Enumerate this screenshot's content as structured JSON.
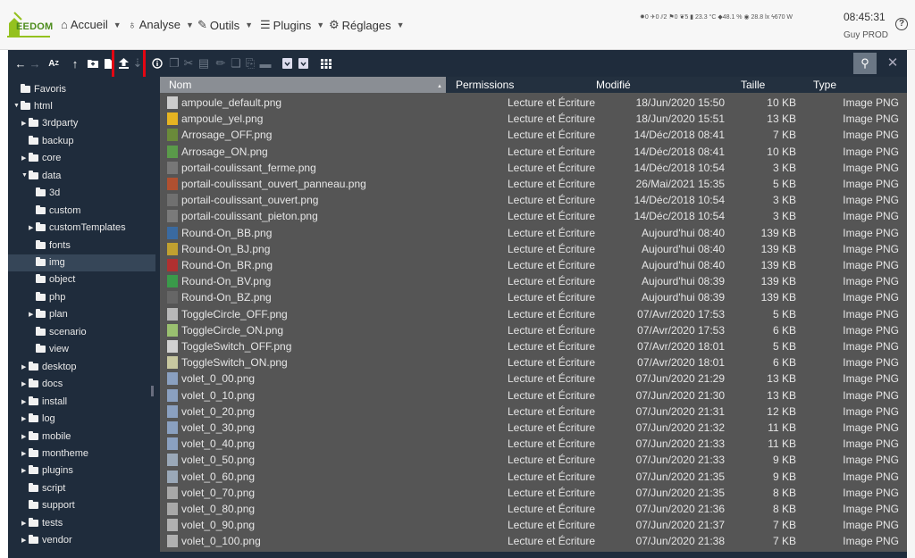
{
  "nav": {
    "logo_text": "EEDOM",
    "items": [
      {
        "label": "Accueil",
        "icon": "home-icon"
      },
      {
        "label": "Analyse",
        "icon": "stethoscope-icon"
      },
      {
        "label": "Outils",
        "icon": "wrench-icon"
      },
      {
        "label": "Plugins",
        "icon": "list-icon"
      },
      {
        "label": "Réglages",
        "icon": "gear-icon"
      }
    ],
    "status_strip": "✹0 ✈0 ⫽2 ⚑0 ❦5 ▮ 23.3 °C ◆48.1 % ◉ 28.8 lx ϟ670 W",
    "time": "08:45:31",
    "user": "Guy PROD",
    "help": "?"
  },
  "colors": {
    "accent": "#e30613",
    "toolbar_bg": "#1f2c3c",
    "list_bg": "#555555",
    "header_sel": "#8a8e94"
  },
  "toolbar": {
    "icons": [
      "arrow-left-icon",
      "arrow-right-icon",
      "sort-az-icon",
      "arrow-up-icon",
      "new-folder-icon",
      "new-file-icon",
      "upload-icon",
      "download-icon",
      "info-icon",
      "copy-icon",
      "cut-icon",
      "paste-icon",
      "rename-icon",
      "duplicate-icon",
      "extract-icon",
      "trash-icon",
      "archive-icon",
      "unarchive-icon",
      "grid-view-icon",
      "search-icon",
      "close-icon"
    ],
    "highlighted": "upload-icon"
  },
  "tree": [
    {
      "label": "Favoris",
      "level": 0,
      "twisty": "",
      "icon": "bookmark"
    },
    {
      "label": "html",
      "level": 0,
      "twisty": "▼"
    },
    {
      "label": "3rdparty",
      "level": 1,
      "twisty": "▶"
    },
    {
      "label": "backup",
      "level": 1,
      "twisty": ""
    },
    {
      "label": "core",
      "level": 1,
      "twisty": "▶"
    },
    {
      "label": "data",
      "level": 1,
      "twisty": "▼"
    },
    {
      "label": "3d",
      "level": 2,
      "twisty": ""
    },
    {
      "label": "custom",
      "level": 2,
      "twisty": ""
    },
    {
      "label": "customTemplates",
      "level": 2,
      "twisty": "▶"
    },
    {
      "label": "fonts",
      "level": 2,
      "twisty": ""
    },
    {
      "label": "img",
      "level": 2,
      "twisty": "",
      "selected": true
    },
    {
      "label": "object",
      "level": 2,
      "twisty": ""
    },
    {
      "label": "php",
      "level": 2,
      "twisty": ""
    },
    {
      "label": "plan",
      "level": 2,
      "twisty": "▶"
    },
    {
      "label": "scenario",
      "level": 2,
      "twisty": ""
    },
    {
      "label": "view",
      "level": 2,
      "twisty": ""
    },
    {
      "label": "desktop",
      "level": 1,
      "twisty": "▶"
    },
    {
      "label": "docs",
      "level": 1,
      "twisty": "▶"
    },
    {
      "label": "install",
      "level": 1,
      "twisty": "▶"
    },
    {
      "label": "log",
      "level": 1,
      "twisty": "▶"
    },
    {
      "label": "mobile",
      "level": 1,
      "twisty": "▶"
    },
    {
      "label": "montheme",
      "level": 1,
      "twisty": "▶"
    },
    {
      "label": "plugins",
      "level": 1,
      "twisty": "▶"
    },
    {
      "label": "script",
      "level": 1,
      "twisty": ""
    },
    {
      "label": "support",
      "level": 1,
      "twisty": ""
    },
    {
      "label": "tests",
      "level": 1,
      "twisty": "▶"
    },
    {
      "label": "vendor",
      "level": 1,
      "twisty": "▶"
    }
  ],
  "columns": {
    "name": "Nom",
    "perms": "Permissions",
    "mod": "Modifié",
    "size": "Taille",
    "type": "Type"
  },
  "files": [
    {
      "name": "ampoule_default.png",
      "perm": "Lecture et Écriture",
      "mod": "18/Jun/2020 15:50",
      "size": "10 KB",
      "type": "Image PNG",
      "thumb": "#cccccc"
    },
    {
      "name": "ampoule_yel.png",
      "perm": "Lecture et Écriture",
      "mod": "18/Jun/2020 15:51",
      "size": "13 KB",
      "type": "Image PNG",
      "thumb": "#e6b422"
    },
    {
      "name": "Arrosage_OFF.png",
      "perm": "Lecture et Écriture",
      "mod": "14/Déc/2018 08:41",
      "size": "7 KB",
      "type": "Image PNG",
      "thumb": "#6a8a3a"
    },
    {
      "name": "Arrosage_ON.png",
      "perm": "Lecture et Écriture",
      "mod": "14/Déc/2018 08:41",
      "size": "10 KB",
      "type": "Image PNG",
      "thumb": "#5a9a4a"
    },
    {
      "name": "portail-coulissant_ferme.png",
      "perm": "Lecture et Écriture",
      "mod": "14/Déc/2018 10:54",
      "size": "3 KB",
      "type": "Image PNG",
      "thumb": "#777777"
    },
    {
      "name": "portail-coulissant_ouvert_panneau.png",
      "perm": "Lecture et Écriture",
      "mod": "26/Mai/2021 15:35",
      "size": "5 KB",
      "type": "Image PNG",
      "thumb": "#b05030"
    },
    {
      "name": "portail-coulissant_ouvert.png",
      "perm": "Lecture et Écriture",
      "mod": "14/Déc/2018 10:54",
      "size": "3 KB",
      "type": "Image PNG",
      "thumb": "#707070"
    },
    {
      "name": "portail-coulissant_pieton.png",
      "perm": "Lecture et Écriture",
      "mod": "14/Déc/2018 10:54",
      "size": "3 KB",
      "type": "Image PNG",
      "thumb": "#7a7a7a"
    },
    {
      "name": "Round-On_BB.png",
      "perm": "Lecture et Écriture",
      "mod": "Aujourd'hui 08:40",
      "size": "139 KB",
      "type": "Image PNG",
      "thumb": "#3a6aa0"
    },
    {
      "name": "Round-On_BJ.png",
      "perm": "Lecture et Écriture",
      "mod": "Aujourd'hui 08:40",
      "size": "139 KB",
      "type": "Image PNG",
      "thumb": "#c0a030"
    },
    {
      "name": "Round-On_BR.png",
      "perm": "Lecture et Écriture",
      "mod": "Aujourd'hui 08:40",
      "size": "139 KB",
      "type": "Image PNG",
      "thumb": "#b03030"
    },
    {
      "name": "Round-On_BV.png",
      "perm": "Lecture et Écriture",
      "mod": "Aujourd'hui 08:39",
      "size": "139 KB",
      "type": "Image PNG",
      "thumb": "#3a9a4a"
    },
    {
      "name": "Round-On_BZ.png",
      "perm": "Lecture et Écriture",
      "mod": "Aujourd'hui 08:39",
      "size": "139 KB",
      "type": "Image PNG",
      "thumb": "#666666"
    },
    {
      "name": "ToggleCircle_OFF.png",
      "perm": "Lecture et Écriture",
      "mod": "07/Avr/2020 17:53",
      "size": "5 KB",
      "type": "Image PNG",
      "thumb": "#b8b8b8"
    },
    {
      "name": "ToggleCircle_ON.png",
      "perm": "Lecture et Écriture",
      "mod": "07/Avr/2020 17:53",
      "size": "6 KB",
      "type": "Image PNG",
      "thumb": "#9ac070"
    },
    {
      "name": "ToggleSwitch_OFF.png",
      "perm": "Lecture et Écriture",
      "mod": "07/Avr/2020 18:01",
      "size": "5 KB",
      "type": "Image PNG",
      "thumb": "#d0d0d0"
    },
    {
      "name": "ToggleSwitch_ON.png",
      "perm": "Lecture et Écriture",
      "mod": "07/Avr/2020 18:01",
      "size": "6 KB",
      "type": "Image PNG",
      "thumb": "#c8c8a0"
    },
    {
      "name": "volet_0_00.png",
      "perm": "Lecture et Écriture",
      "mod": "07/Jun/2020 21:29",
      "size": "13 KB",
      "type": "Image PNG",
      "thumb": "#8aa0c0"
    },
    {
      "name": "volet_0_10.png",
      "perm": "Lecture et Écriture",
      "mod": "07/Jun/2020 21:30",
      "size": "13 KB",
      "type": "Image PNG",
      "thumb": "#8aa0c0"
    },
    {
      "name": "volet_0_20.png",
      "perm": "Lecture et Écriture",
      "mod": "07/Jun/2020 21:31",
      "size": "12 KB",
      "type": "Image PNG",
      "thumb": "#8aa0c0"
    },
    {
      "name": "volet_0_30.png",
      "perm": "Lecture et Écriture",
      "mod": "07/Jun/2020 21:32",
      "size": "11 KB",
      "type": "Image PNG",
      "thumb": "#8aa0c0"
    },
    {
      "name": "volet_0_40.png",
      "perm": "Lecture et Écriture",
      "mod": "07/Jun/2020 21:33",
      "size": "11 KB",
      "type": "Image PNG",
      "thumb": "#8aa0c0"
    },
    {
      "name": "volet_0_50.png",
      "perm": "Lecture et Écriture",
      "mod": "07/Jun/2020 21:33",
      "size": "9 KB",
      "type": "Image PNG",
      "thumb": "#9aa8b8"
    },
    {
      "name": "volet_0_60.png",
      "perm": "Lecture et Écriture",
      "mod": "07/Jun/2020 21:35",
      "size": "9 KB",
      "type": "Image PNG",
      "thumb": "#9aa8b8"
    },
    {
      "name": "volet_0_70.png",
      "perm": "Lecture et Écriture",
      "mod": "07/Jun/2020 21:35",
      "size": "8 KB",
      "type": "Image PNG",
      "thumb": "#a8a8a8"
    },
    {
      "name": "volet_0_80.png",
      "perm": "Lecture et Écriture",
      "mod": "07/Jun/2020 21:36",
      "size": "8 KB",
      "type": "Image PNG",
      "thumb": "#a8a8a8"
    },
    {
      "name": "volet_0_90.png",
      "perm": "Lecture et Écriture",
      "mod": "07/Jun/2020 21:37",
      "size": "7 KB",
      "type": "Image PNG",
      "thumb": "#b0b0b0"
    },
    {
      "name": "volet_0_100.png",
      "perm": "Lecture et Écriture",
      "mod": "07/Jun/2020 21:38",
      "size": "7 KB",
      "type": "Image PNG",
      "thumb": "#b0b0b0"
    }
  ]
}
